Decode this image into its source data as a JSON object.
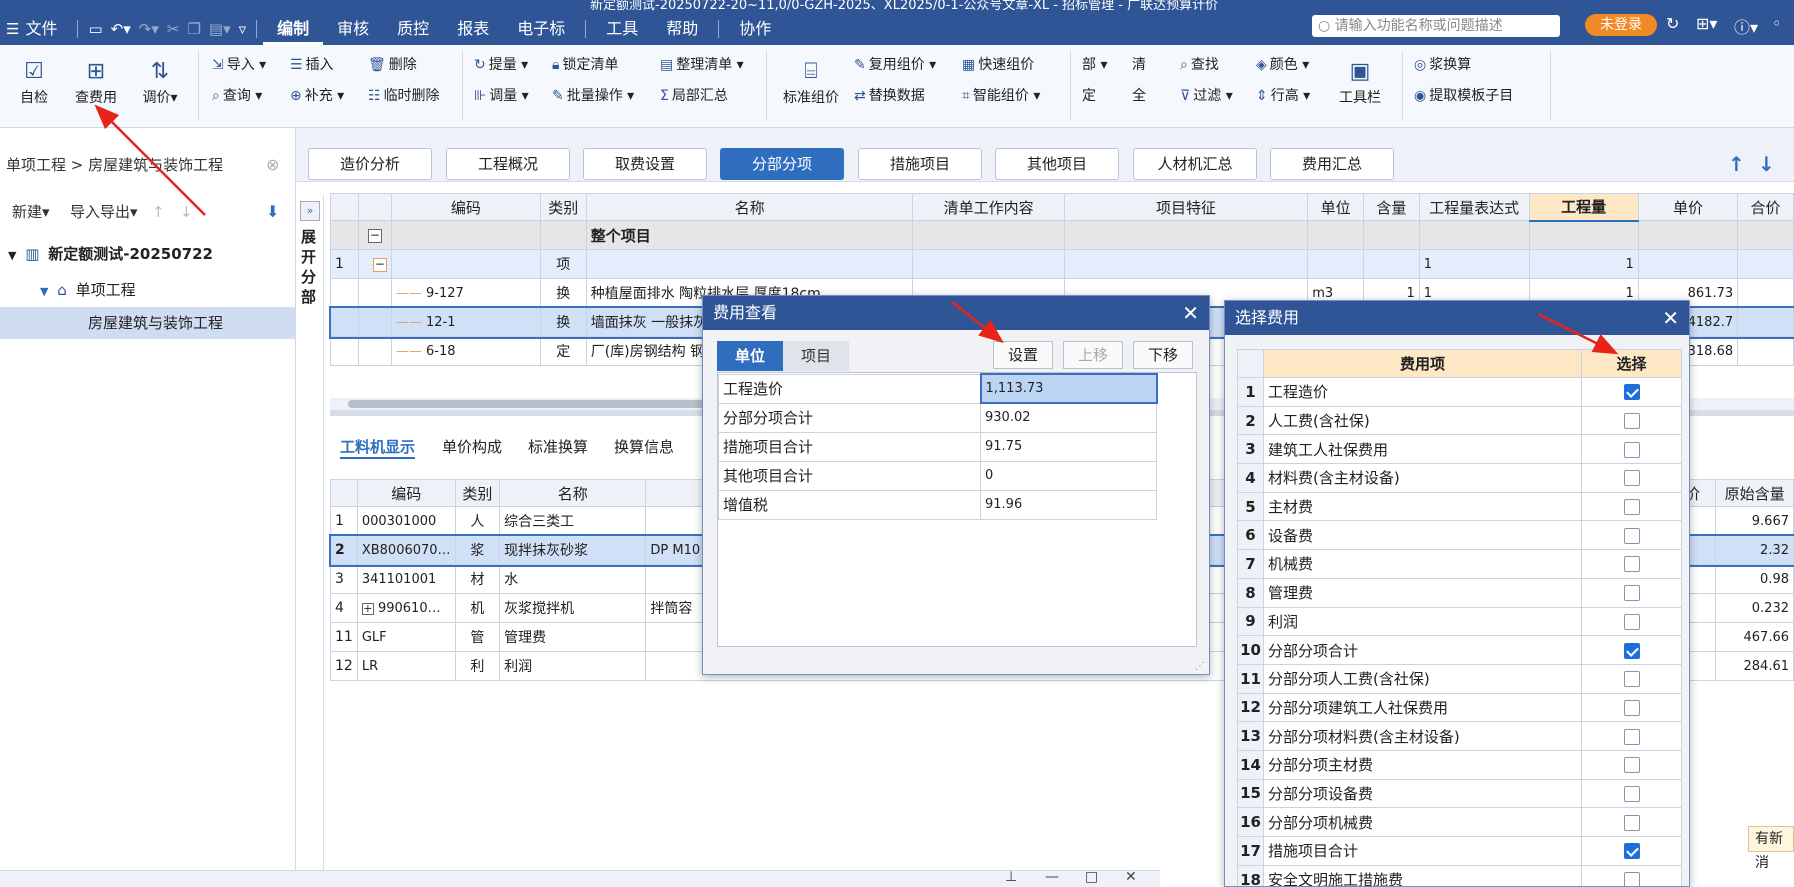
{
  "window": {
    "title": "新定额测试-20250722-20~11,0/0-GZH-2025、XL2025/0-1-公众号文章-XL - 招标管理 - 广联达预算计价"
  },
  "menu": {
    "file": "文件",
    "items": [
      "编制",
      "审核",
      "质控",
      "报表",
      "电子标",
      "工具",
      "帮助",
      "协作"
    ]
  },
  "search": {
    "placeholder": "请输入功能名称或问题描述"
  },
  "login": {
    "label": "未登录"
  },
  "ribbon": {
    "big": {
      "check": "自检",
      "view_fee": "查费用",
      "adjust": "调价",
      "std_group": "标准组价",
      "toolbar": "工具栏"
    },
    "small": {
      "import": "导入",
      "query": "查询",
      "insert": "插入",
      "supplement": "补充",
      "delete": "删除",
      "temp_delete": "临时删除",
      "extract": "提量",
      "adjust_qty": "调量",
      "lock_list": "锁定清单",
      "batch_op": "批量操作",
      "organize_list": "整理清单",
      "local_sum": "局部汇总",
      "reuse_group": "复用组价",
      "replace_data": "替换数据",
      "quick_group": "快速组价",
      "smart_group": "智能组价",
      "find": "查找",
      "filter": "过滤",
      "color": "颜色",
      "row_height": "行高",
      "slurry_calc": "浆换算",
      "extract_template": "提取模板子目",
      "g1": "部",
      "g2": "清",
      "g3": "定",
      "g4": "全"
    }
  },
  "left": {
    "breadcrumb": "单项工程 > 房屋建筑与装饰工程",
    "new": "新建",
    "import_export": "导入导出",
    "tree": [
      "新定额测试-20250722",
      "单项工程",
      "房屋建筑与装饰工程"
    ]
  },
  "tabs": [
    "造价分析",
    "工程概况",
    "取费设置",
    "分部分项",
    "措施项目",
    "其他项目",
    "人材机汇总",
    "费用汇总"
  ],
  "expand_label": "展开分部",
  "grid": {
    "headers": [
      "编码",
      "类别",
      "名称",
      "清单工作内容",
      "项目特征",
      "单位",
      "含量",
      "工程量表达式",
      "工程量",
      "单价",
      "合价"
    ],
    "group_label": "整个项目",
    "rows": [
      {
        "no": "1",
        "code": "",
        "type": "项",
        "name": "",
        "unit": "",
        "content": "",
        "expr": "1",
        "qty": "1",
        "price": ""
      },
      {
        "no": "",
        "code": "9-127",
        "type": "换",
        "name": "种植屋面排水 陶粒排水层 厚度18cm",
        "unit": "m3",
        "content": "1",
        "expr": "1",
        "qty": "1",
        "price": "861.73"
      },
      {
        "no": "",
        "code": "12-1",
        "type": "换",
        "name": "墙面抹灰 一般抹灰 内",
        "unit": "",
        "content": "",
        "expr": "",
        "qty": "",
        "price": "4182.7"
      },
      {
        "no": "",
        "code": "6-18",
        "type": "定",
        "name": "厂(库)房钢结构 钢柱",
        "unit": "",
        "content": "",
        "expr": "",
        "qty": "",
        "price": "318.68"
      }
    ]
  },
  "sub_tabs": [
    "工料机显示",
    "单价构成",
    "标准换算",
    "换算信息"
  ],
  "sub_grid": {
    "headers": [
      "编码",
      "类别",
      "名称",
      "价",
      "原始含量"
    ],
    "rows": [
      {
        "no": "1",
        "code": "000301000",
        "type": "人",
        "name": "综合三类工",
        "spec": "",
        "orig": "9.667"
      },
      {
        "no": "2",
        "code": "XB8006070…",
        "type": "浆",
        "name": "现拌抹灰砂浆",
        "spec": "DP M10",
        "orig": "2.32"
      },
      {
        "no": "3",
        "code": "341101001",
        "type": "材",
        "name": "水",
        "spec": "",
        "orig": "0.98"
      },
      {
        "no": "4",
        "code": "990610…",
        "type": "机",
        "name": "灰浆搅拌机",
        "spec": "拌筒容",
        "orig": "0.232"
      },
      {
        "no": "11",
        "code": "GLF",
        "type": "管",
        "name": "管理费",
        "spec": "",
        "orig": "467.66"
      },
      {
        "no": "12",
        "code": "LR",
        "type": "利",
        "name": "利润",
        "spec": "",
        "orig": "284.61"
      }
    ]
  },
  "fee_dialog": {
    "title": "费用查看",
    "tabs": [
      "单位",
      "项目"
    ],
    "buttons": {
      "settings": "设置",
      "up": "上移",
      "down": "下移"
    },
    "rows": [
      {
        "label": "工程造价",
        "value": "1,113.73"
      },
      {
        "label": "分部分项合计",
        "value": "930.02"
      },
      {
        "label": "措施项目合计",
        "value": "91.75"
      },
      {
        "label": "其他项目合计",
        "value": "0"
      },
      {
        "label": "增值税",
        "value": "91.96"
      }
    ]
  },
  "select_dialog": {
    "title": "选择费用",
    "headers": [
      "费用项",
      "选择"
    ],
    "rows": [
      {
        "no": "1",
        "label": "工程造价",
        "checked": true
      },
      {
        "no": "2",
        "label": "人工费(含社保)",
        "checked": false
      },
      {
        "no": "3",
        "label": "建筑工人社保费用",
        "checked": false
      },
      {
        "no": "4",
        "label": "材料费(含主材设备)",
        "checked": false
      },
      {
        "no": "5",
        "label": "主材费",
        "checked": false
      },
      {
        "no": "6",
        "label": "设备费",
        "checked": false
      },
      {
        "no": "7",
        "label": "机械费",
        "checked": false
      },
      {
        "no": "8",
        "label": "管理费",
        "checked": false
      },
      {
        "no": "9",
        "label": "利润",
        "checked": false
      },
      {
        "no": "10",
        "label": "分部分项合计",
        "checked": true
      },
      {
        "no": "11",
        "label": "分部分项人工费(含社保)",
        "checked": false
      },
      {
        "no": "12",
        "label": "分部分项建筑工人社保费用",
        "checked": false
      },
      {
        "no": "13",
        "label": "分部分项材料费(含主材设备)",
        "checked": false
      },
      {
        "no": "14",
        "label": "分部分项主材费",
        "checked": false
      },
      {
        "no": "15",
        "label": "分部分项设备费",
        "checked": false
      },
      {
        "no": "16",
        "label": "分部分项机械费",
        "checked": false
      },
      {
        "no": "17",
        "label": "措施项目合计",
        "checked": true
      },
      {
        "no": "18",
        "label": "安全文明施工措施费",
        "checked": false
      }
    ]
  },
  "news": {
    "label": "有新消"
  },
  "colors": {
    "accent": "#2f5597",
    "tab_active": "#2f6ebf",
    "login": "#f08a24",
    "annotation": "#e8231a"
  }
}
